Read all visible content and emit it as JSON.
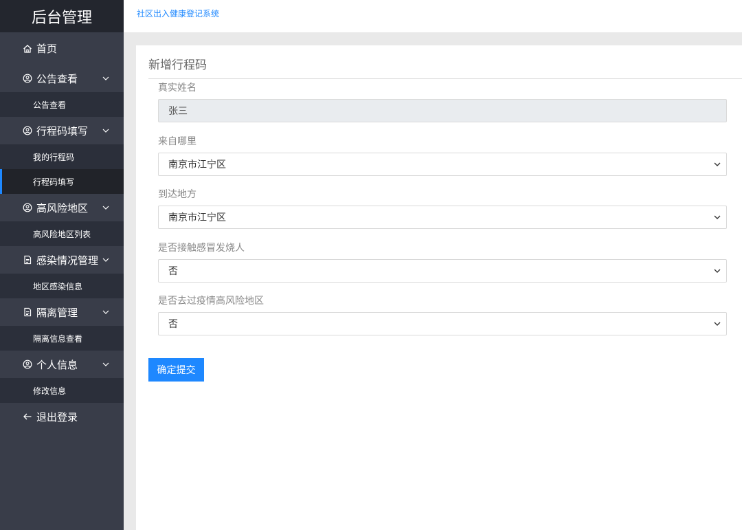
{
  "brand": "后台管理",
  "topbar": {
    "system_link": "社区出入健康登记系统"
  },
  "sidebar": {
    "home": "首页",
    "groups": [
      {
        "label": "公告查看",
        "sub": [
          "公告查看"
        ]
      },
      {
        "label": "行程码填写",
        "sub": [
          "我的行程码",
          "行程码填写"
        ]
      },
      {
        "label": "高风险地区",
        "sub": [
          "高风险地区列表"
        ]
      },
      {
        "label": "感染情况管理",
        "sub": [
          "地区感染信息"
        ]
      },
      {
        "label": "隔离管理",
        "sub": [
          "隔离信息查看"
        ]
      },
      {
        "label": "个人信息",
        "sub": [
          "修改信息"
        ]
      }
    ],
    "logout": "退出登录",
    "active_item": "行程码填写"
  },
  "form": {
    "title": "新增行程码",
    "fields": [
      {
        "label": "真实姓名",
        "value": "张三",
        "type": "readonly"
      },
      {
        "label": "来自哪里",
        "value": "南京市江宁区",
        "type": "select"
      },
      {
        "label": "到达地方",
        "value": "南京市江宁区",
        "type": "select"
      },
      {
        "label": "是否接触感冒发烧人",
        "value": "否",
        "type": "select"
      },
      {
        "label": "是否去过疫情高风险地区",
        "value": "否",
        "type": "select"
      }
    ],
    "submit_label": "确定提交"
  },
  "colors": {
    "sidebar_bg": "#393d49",
    "brand_bg": "#23262e",
    "submenu_bg": "#2b2f3a",
    "active_bg": "#212329",
    "accent": "#1e88ff"
  }
}
